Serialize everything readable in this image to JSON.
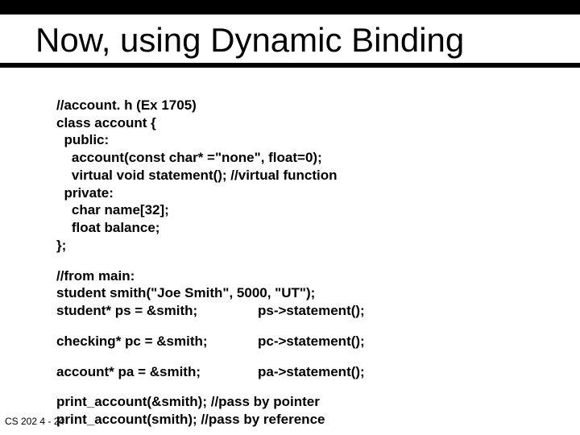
{
  "title": "Now, using Dynamic Binding",
  "code": {
    "l1": "//account. h (Ex 1705)",
    "l2": "class account {",
    "l3": "  public:",
    "l4": "    account(const char* =\"none\", float=0);",
    "l5": "    virtual void statement(); //virtual function",
    "l6": "  private:",
    "l7": "    char name[32];",
    "l8": "    float balance;",
    "l9": "};"
  },
  "main": {
    "l1": "//from main:",
    "l2": "  student smith(\"Joe Smith\", 5000, \"UT\");",
    "l3a": "  student* ps = &smith;",
    "l3b": "ps->statement();",
    "l4a": "  checking* pc = &smith;",
    "l4b": "pc->statement();",
    "l5a": "  account* pa = &smith;",
    "l5b": "pa->statement();",
    "l6": "  print_account(&smith); //pass by pointer",
    "l7": "  print_account(smith);  //pass by reference"
  },
  "footer": "CS 202   4 - 24"
}
